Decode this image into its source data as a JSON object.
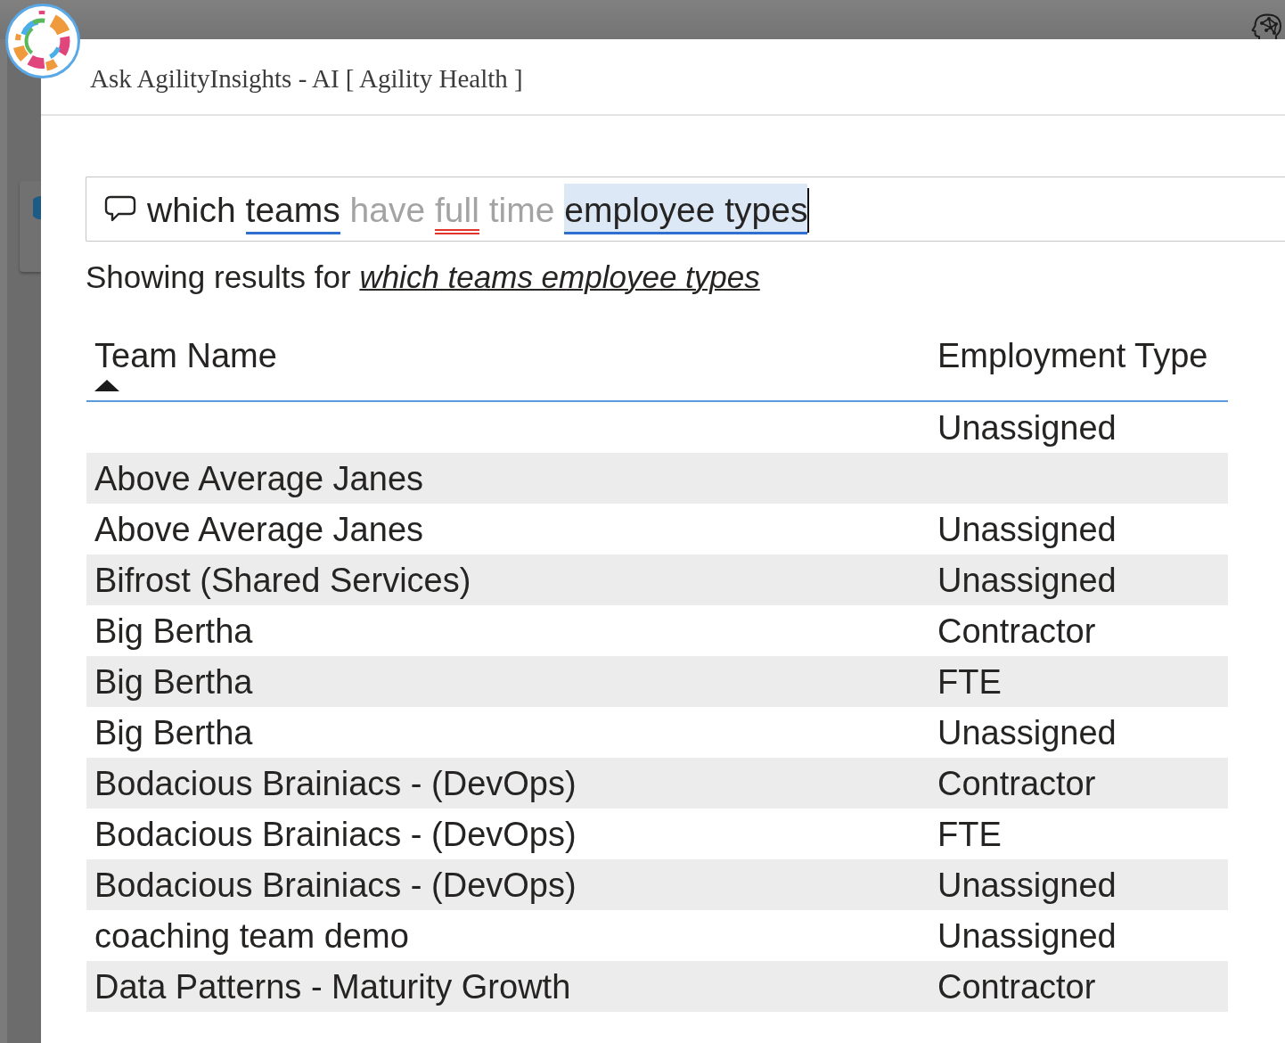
{
  "window": {
    "title": "Ask AgilityInsights - AI [ Agility Health ]"
  },
  "search": {
    "focused": true,
    "tokens": [
      {
        "text": "which",
        "kind": "plain"
      },
      {
        "text": "teams",
        "kind": "term"
      },
      {
        "text": "have",
        "kind": "ignored"
      },
      {
        "text": "full",
        "kind": "misspelled"
      },
      {
        "text": "time",
        "kind": "ignored"
      },
      {
        "text": "employee types",
        "kind": "highlighted_term"
      }
    ]
  },
  "interpretation": {
    "prefix": "Showing results for",
    "query": "which teams employee types"
  },
  "table": {
    "columns": [
      {
        "label": "Team Name",
        "sorted": true,
        "ascending": true
      },
      {
        "label": "Employment Type",
        "sorted": false
      }
    ],
    "rows": [
      {
        "employment_type": "Unassigned"
      },
      {
        "team_name": "Above Average Janes"
      },
      {
        "team_name": "Above Average Janes",
        "employment_type": "Unassigned"
      },
      {
        "team_name": "Bifrost (Shared Services)",
        "employment_type": "Unassigned"
      },
      {
        "team_name": "Big Bertha",
        "employment_type": "Contractor"
      },
      {
        "team_name": "Big Bertha",
        "employment_type": "FTE"
      },
      {
        "team_name": "Big Bertha",
        "employment_type": "Unassigned"
      },
      {
        "team_name": "Bodacious Brainiacs - (DevOps)",
        "employment_type": "Contractor"
      },
      {
        "team_name": "Bodacious Brainiacs - (DevOps)",
        "employment_type": "FTE"
      },
      {
        "team_name": "Bodacious Brainiacs - (DevOps)",
        "employment_type": "Unassigned"
      },
      {
        "team_name": "coaching team demo",
        "employment_type": "Unassigned"
      },
      {
        "team_name": "Data Patterns - Maturity Growth",
        "employment_type": "Contractor"
      }
    ]
  }
}
